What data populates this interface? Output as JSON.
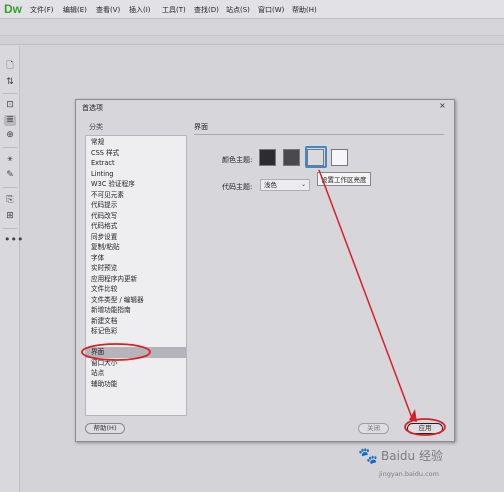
{
  "app": {
    "logo": "Dw",
    "menu": [
      "文件(F)",
      "编辑(E)",
      "查看(V)",
      "插入(I)",
      "工具(T)",
      "查找(D)",
      "站点(S)",
      "窗口(W)",
      "帮助(H)"
    ]
  },
  "toolbar": {
    "icons": [
      "file-icon",
      "sort-icon",
      "inspect-icon",
      "code-nav-icon",
      "target-icon",
      "wand-icon",
      "brush-icon",
      "snippet-icon",
      "panel-icon",
      "more-icon"
    ]
  },
  "dialog": {
    "title": "首选项",
    "close_glyph": "×",
    "category_label": "分类",
    "categories": [
      "常规",
      "CSS 样式",
      "Extract",
      "Linting",
      "W3C 验证程序",
      "不可见元素",
      "代码提示",
      "代码改写",
      "代码格式",
      "同步设置",
      "复制/粘贴",
      "字体",
      "实时预览",
      "应用程序内更新",
      "文件比较",
      "文件类型 / 编辑器",
      "新增功能指南",
      "新建文档",
      "标记色彩",
      "界面",
      "窗口大小",
      "站点",
      "辅助功能"
    ],
    "selected_category": "界面",
    "section_title": "界面",
    "color_theme_label": "颜色主题:",
    "swatches": [
      "#2d2d2f",
      "#4a4a4d",
      "#d9d9de",
      "#f6f6f8"
    ],
    "selected_swatch_index": 2,
    "tooltip": "设置工作区亮度",
    "code_theme_label": "代码主题:",
    "code_theme_value": "浅色",
    "help_button": "帮助(H)",
    "close_button": "关闭",
    "apply_button": "应用"
  },
  "watermark": {
    "text": "Baidu 经验",
    "url": "jingyan.baidu.com"
  },
  "colors": {
    "annotation_red": "#d8202a",
    "selection_blue": "#3f88c8"
  }
}
